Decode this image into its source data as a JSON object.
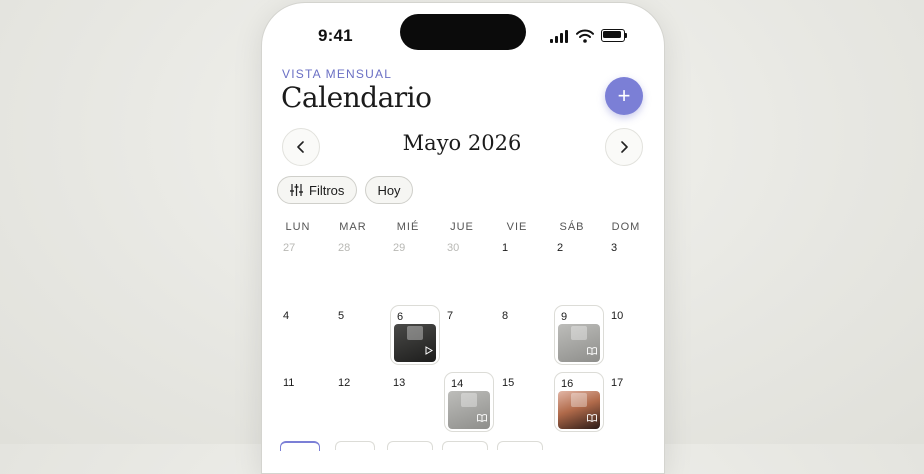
{
  "status_bar": {
    "time": "9:41"
  },
  "header": {
    "eyebrow": "VISTA MENSUAL",
    "title": "Calendario",
    "add_label": "+"
  },
  "nav": {
    "month_label": "Mayo 2026"
  },
  "filters": {
    "filters_label": "Filtros",
    "today_label": "Hoy"
  },
  "weekdays": [
    "LUN",
    "MAR",
    "MIÉ",
    "JUE",
    "VIE",
    "SÁB",
    "DOM"
  ],
  "weeks": [
    [
      "27",
      "28",
      "29",
      "30",
      "1",
      "2",
      "3"
    ],
    [
      "4",
      "5",
      "6",
      "7",
      "8",
      "9",
      "10"
    ],
    [
      "11",
      "12",
      "13",
      "14",
      "15",
      "16",
      "17"
    ]
  ],
  "events": [
    {
      "day": "6",
      "kind": "video",
      "style": "dark"
    },
    {
      "day": "9",
      "kind": "book",
      "style": "gray"
    },
    {
      "day": "14",
      "kind": "book",
      "style": "gray"
    },
    {
      "day": "16",
      "kind": "book",
      "style": "warm"
    }
  ],
  "colors": {
    "accent": "#7b7fd6",
    "eyebrow": "#6a6fc4",
    "muted_day": "#b8b8b4"
  }
}
